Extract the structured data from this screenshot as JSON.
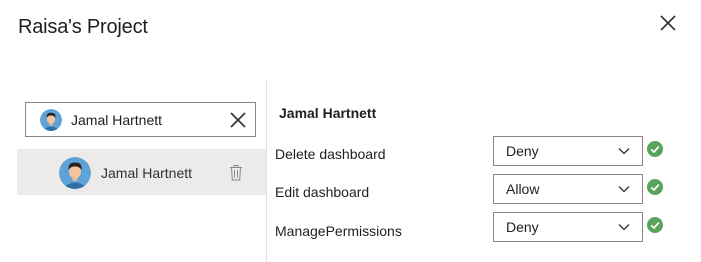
{
  "dialog": {
    "title": "Raisa's Project",
    "close_icon": "close-icon"
  },
  "search": {
    "value": "Jamal Hartnett",
    "avatar_icon": "person-avatar",
    "clear_icon": "close-icon"
  },
  "users": [
    {
      "name": "Jamal Hartnett",
      "delete_icon": "trash-icon"
    }
  ],
  "details": {
    "user_name": "Jamal Hartnett",
    "permissions": [
      {
        "label": "Delete dashboard",
        "value": "Deny",
        "status_icon": "check-circle-icon"
      },
      {
        "label": "Edit dashboard",
        "value": "Allow",
        "status_icon": "check-circle-icon"
      },
      {
        "label": "ManagePermissions",
        "value": "Deny",
        "status_icon": "check-circle-icon"
      }
    ]
  },
  "colors": {
    "check": "#5ba35c",
    "selected_row": "#edebe9",
    "border": "#8a8886"
  }
}
